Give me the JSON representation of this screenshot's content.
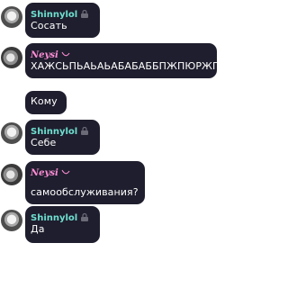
{
  "messages": [
    {
      "author": "Shinnylol",
      "author_style": "teal",
      "badge_icon": "lock-icon",
      "text": "Сосать"
    },
    {
      "author": "Neysi",
      "author_style": "pink",
      "badge_icon": "hook-icon",
      "text": "ХАЖСЬПЬАЬАЬАБАБАББПЖПЮРЖП"
    },
    {
      "text": "Кому"
    },
    {
      "author": "Shinnylol",
      "author_style": "teal",
      "badge_icon": "lock-icon",
      "text": "Себе"
    },
    {
      "author": "Neysi",
      "author_style": "pink",
      "badge_icon": "hook-icon",
      "text": "самообслуживания?"
    },
    {
      "author": "Shinnylol",
      "author_style": "teal",
      "badge_icon": "lock-icon",
      "text": "Да"
    }
  ]
}
